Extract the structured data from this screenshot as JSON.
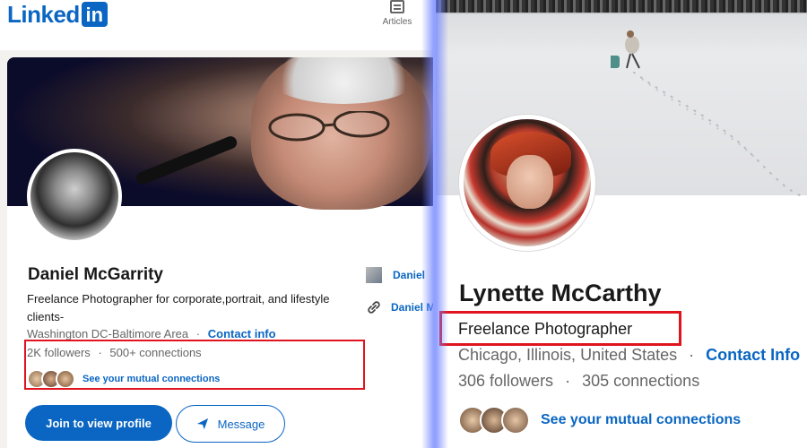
{
  "left_profile": {
    "logo_text": "Linked",
    "logo_badge": "in",
    "nav": {
      "articles_label": "Articles",
      "articles_icon": "articles-icon"
    },
    "name": "Daniel McGarrity",
    "headline": "Freelance Photographer for corporate,portrait, and lifestyle clients-",
    "location": "Washington DC-Baltimore Area",
    "separator": "·",
    "contact_label": "Contact info",
    "followers": "2K followers",
    "connections": "500+ connections",
    "mutual_label": "See your mutual connections",
    "join_button": "Join to view profile",
    "message_button": "Message",
    "side_links": [
      "Daniel",
      "Daniel M"
    ]
  },
  "right_profile": {
    "name": "Lynette McCarthy",
    "headline": "Freelance Photographer",
    "location": "Chicago, Illinois, United States",
    "separator": "·",
    "contact_label": "Contact Info",
    "followers": "306 followers",
    "connections": "305 connections",
    "mutual_label": "See your mutual connections"
  },
  "colors": {
    "linkedin_blue": "#0a66c2",
    "highlight_red": "#e0141e",
    "divider_glow": "#6e82ff"
  }
}
